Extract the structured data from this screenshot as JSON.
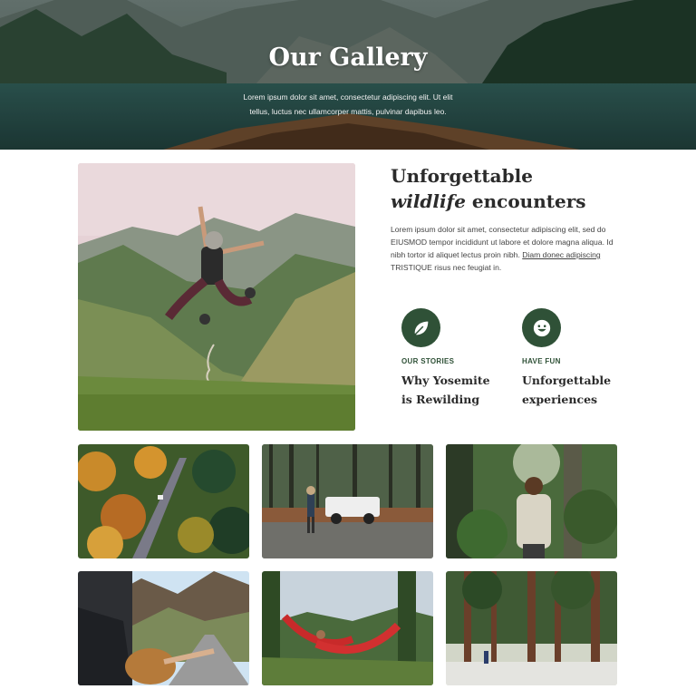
{
  "hero": {
    "title": "Our Gallery",
    "subtitle": "Lorem ipsum dolor sit amet, consectetur adipiscing elit. Ut elit tellus, luctus nec ullamcorper mattis, pulvinar dapibus leo."
  },
  "feature": {
    "title_line1": "Unforgettable",
    "title_italic": "wildlife",
    "title_line2_rest": " encounters",
    "text_before_link": "Lorem ipsum dolor sit amet, consectetur adipiscing elit, sed do EIUSMOD tempor incididunt ut labore et dolore magna aliqua. Id nibh tortor id aliquet lectus proin nibh. ",
    "text_link": "Diam donec adipiscing",
    "text_after_link": " TRISTIQUE risus nec feugiat in."
  },
  "cards": [
    {
      "icon": "leaf-icon",
      "kicker": "OUR STORIES",
      "title": "Why Yosemite is Rewilding"
    },
    {
      "icon": "smiley-icon",
      "kicker": "HAVE FUN",
      "title": "Unforgettable experiences"
    }
  ],
  "colors": {
    "accent": "#2f5137",
    "heading": "#2b2b2b",
    "body": "#444444"
  }
}
